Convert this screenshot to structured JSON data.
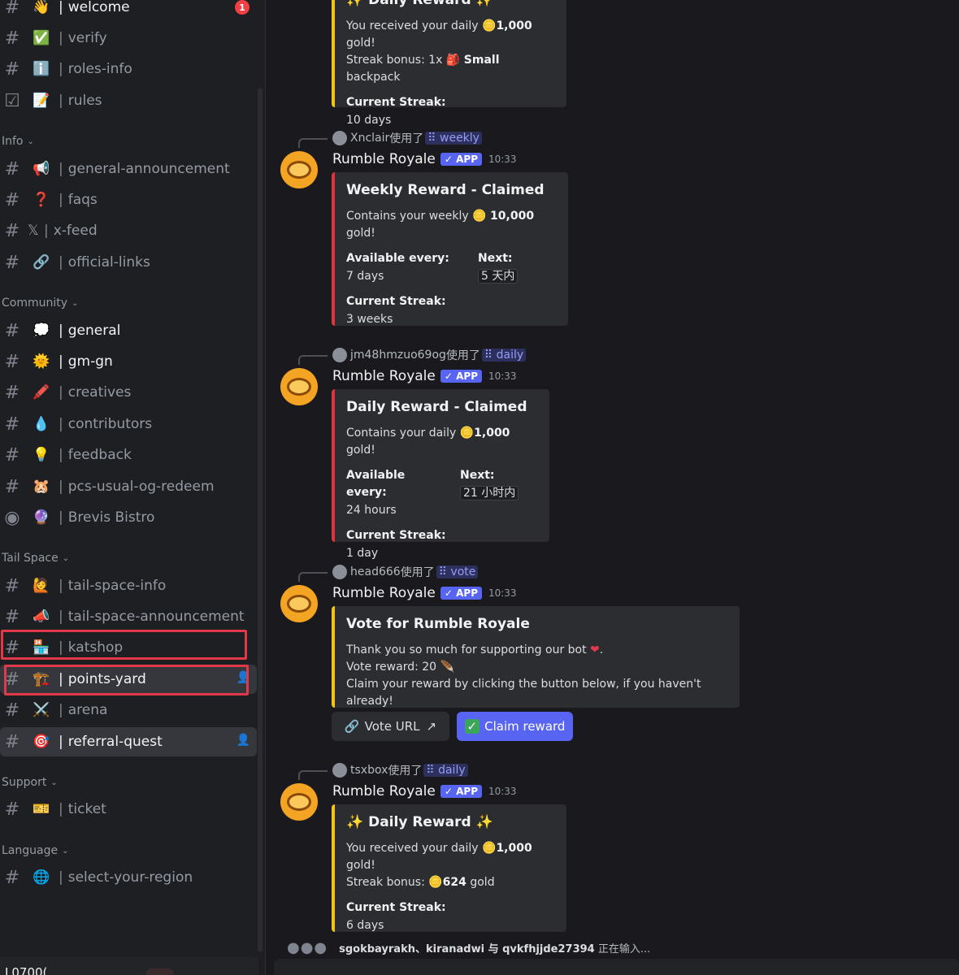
{
  "sidebar": {
    "channels": [
      {
        "name": "welcome",
        "emoji": "👋",
        "badge": "1"
      },
      {
        "name": "verify",
        "emoji": "✅"
      },
      {
        "name": "roles-info",
        "emoji": "ℹ️"
      },
      {
        "name": "rules",
        "emoji": "📝"
      },
      {
        "name": "general-announcement",
        "emoji": "📢"
      },
      {
        "name": "faqs",
        "emoji": "❓"
      },
      {
        "name": "x-feed",
        "emoji": "𝕏"
      },
      {
        "name": "official-links",
        "emoji": "🔗"
      },
      {
        "name": "general",
        "emoji": "💭"
      },
      {
        "name": "gm-gn",
        "emoji": "🌞"
      },
      {
        "name": "creatives",
        "emoji": "🖍️"
      },
      {
        "name": "contributors",
        "emoji": "💧"
      },
      {
        "name": "feedback",
        "emoji": "💡"
      },
      {
        "name": "pcs-usual-og-redeem",
        "emoji": "🐹"
      },
      {
        "name": "Brevis Bistro",
        "emoji": "🔮"
      },
      {
        "name": "tail-space-info",
        "emoji": "🙋"
      },
      {
        "name": "tail-space-announcement",
        "emoji": "📣"
      },
      {
        "name": "katshop",
        "emoji": "🏪"
      },
      {
        "name": "points-yard",
        "emoji": "🏗️"
      },
      {
        "name": "arena",
        "emoji": "⚔️"
      },
      {
        "name": "referral-quest",
        "emoji": "🎯"
      },
      {
        "name": "ticket",
        "emoji": "🎫"
      },
      {
        "name": "select-your-region",
        "emoji": "🌐"
      }
    ],
    "categories": {
      "info": "Info",
      "community": "Community",
      "tail_space": "Tail Space",
      "support": "Support",
      "language": "Language"
    },
    "user": {
      "name": "L0700("
    }
  },
  "messages": {
    "top_embed": {
      "title": "Daily Reward",
      "line1_pre": "You received your daily ",
      "line1_amount": "1,000",
      "line1_post": " gold!",
      "line2_pre": "Streak bonus: 1x ",
      "line2_bold": "Small",
      "line2_post": " backpack",
      "field_title": "Current Streak:",
      "field_value": "10 days"
    },
    "weekly": {
      "reply_user": "Xnclair",
      "reply_used": "使用了",
      "reply_cmd": "weekly",
      "author": "Rumble Royale",
      "app": "✓ APP",
      "time": "10:33",
      "title": "Weekly Reward - Claimed",
      "text_pre": "Contains your weekly ",
      "text_amount": "10,000",
      "text_post": " gold!",
      "f1_title": "Available every:",
      "f1_value": "7 days",
      "f2_title": "Next:",
      "f2_value": "5 天内",
      "f3_title": "Current Streak:",
      "f3_value": "3 weeks"
    },
    "daily1": {
      "reply_user": "jm48hmzuo69og",
      "reply_used": "使用了",
      "reply_cmd": "daily",
      "author": "Rumble Royale",
      "app": "✓ APP",
      "time": "10:33",
      "title": "Daily Reward - Claimed",
      "text_pre": "Contains your daily ",
      "text_amount": "1,000",
      "text_post": " gold!",
      "f1_title": "Available every:",
      "f1_value": "24 hours",
      "f2_title": "Next:",
      "f2_value": "21 小时内",
      "f3_title": "Current Streak:",
      "f3_value": "1 day"
    },
    "vote": {
      "reply_user": "head666",
      "reply_used": "使用了",
      "reply_cmd": "vote",
      "author": "Rumble Royale",
      "app": "✓ APP",
      "time": "10:33",
      "title": "Vote for Rumble Royale",
      "line1": "Thank you so much for supporting our bot",
      "line1_end": ".",
      "line2": "Vote reward: 20",
      "line3": "Claim your reward by clicking the button below, if you haven't already!",
      "btn_vote_url": "Vote URL",
      "btn_claim": "Claim reward"
    },
    "daily2": {
      "reply_user": "tsxbox",
      "reply_used": "使用了",
      "reply_cmd": "daily",
      "author": "Rumble Royale",
      "app": "✓ APP",
      "time": "10:33",
      "title": "Daily Reward",
      "line1_pre": "You received your daily ",
      "line1_amount": "1,000",
      "line1_post": " gold!",
      "line2_pre": "Streak bonus: ",
      "line2_amount": "624",
      "line2_post": " gold",
      "field_title": "Current Streak:",
      "field_value": "6 days"
    },
    "typing": {
      "users": "sgokbayrakh、kiranadwi 与 qvkfhjjde27394",
      "suffix": " 正在输入..."
    }
  },
  "colors": {
    "accent": "#5865f2",
    "embed_gold": "#f0c419",
    "embed_red": "#da373c",
    "highlight_box": "#e0394a"
  }
}
